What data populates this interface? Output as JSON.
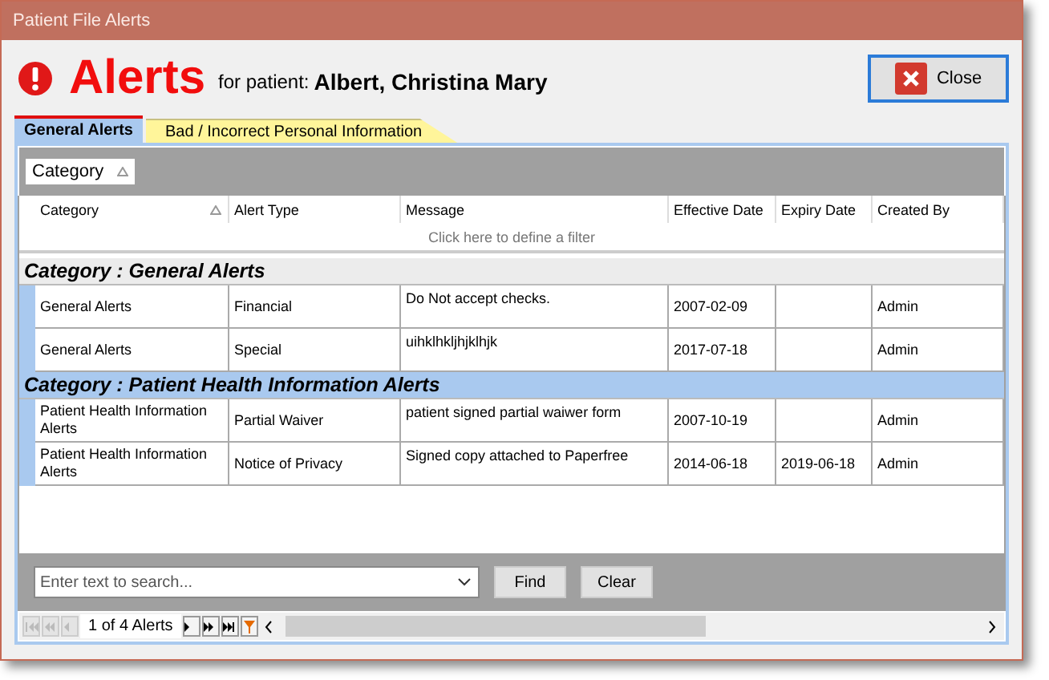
{
  "window": {
    "title": "Patient File Alerts"
  },
  "header": {
    "title": "Alerts",
    "patient_label": "for patient:",
    "patient_name": "Albert, Christina Mary",
    "close_button": "Close"
  },
  "tabs": [
    {
      "label": "General Alerts",
      "selected": true
    },
    {
      "label": "Bad / Incorrect Personal Information",
      "selected": false
    }
  ],
  "group_by": [
    "Category"
  ],
  "columns": [
    {
      "label": "Category",
      "sorted": true
    },
    {
      "label": "Alert Type",
      "sorted": false
    },
    {
      "label": "Message",
      "sorted": false
    },
    {
      "label": "Effective Date",
      "sorted": false
    },
    {
      "label": "Expiry Date",
      "sorted": false
    },
    {
      "label": "Created By",
      "sorted": false
    }
  ],
  "filter_hint": "Click here to define a filter",
  "groups": [
    {
      "title": "Category : General Alerts",
      "selected": false,
      "rows": [
        [
          "General Alerts",
          "Financial",
          "Do Not accept checks.",
          "2007-02-09",
          "",
          "Admin"
        ],
        [
          "General Alerts",
          "Special",
          "uihklhkljhjklhjk",
          "2017-07-18",
          "",
          "Admin"
        ]
      ]
    },
    {
      "title": "Category : Patient Health Information Alerts",
      "selected": true,
      "rows": [
        [
          "Patient Health Information Alerts",
          "Partial Waiver",
          "patient signed partial waiwer form",
          "2007-10-19",
          "",
          "Admin"
        ],
        [
          "Patient Health Information Alerts",
          "Notice of Privacy",
          "Signed copy attached to Paperfree",
          "2014-06-18",
          "2019-06-18",
          "Admin"
        ]
      ]
    }
  ],
  "search": {
    "placeholder": "Enter text to search...",
    "find": "Find",
    "clear": "Clear"
  },
  "navigator": {
    "position": "1 of 4 Alerts",
    "buttons": [
      {
        "kind": "first",
        "disabled": true
      },
      {
        "kind": "prev-page",
        "disabled": true
      },
      {
        "kind": "prev",
        "disabled": true
      },
      {
        "kind": "next",
        "disabled": false
      },
      {
        "kind": "next-page",
        "disabled": false
      },
      {
        "kind": "last",
        "disabled": false
      },
      {
        "kind": "filter",
        "disabled": false
      }
    ]
  }
}
